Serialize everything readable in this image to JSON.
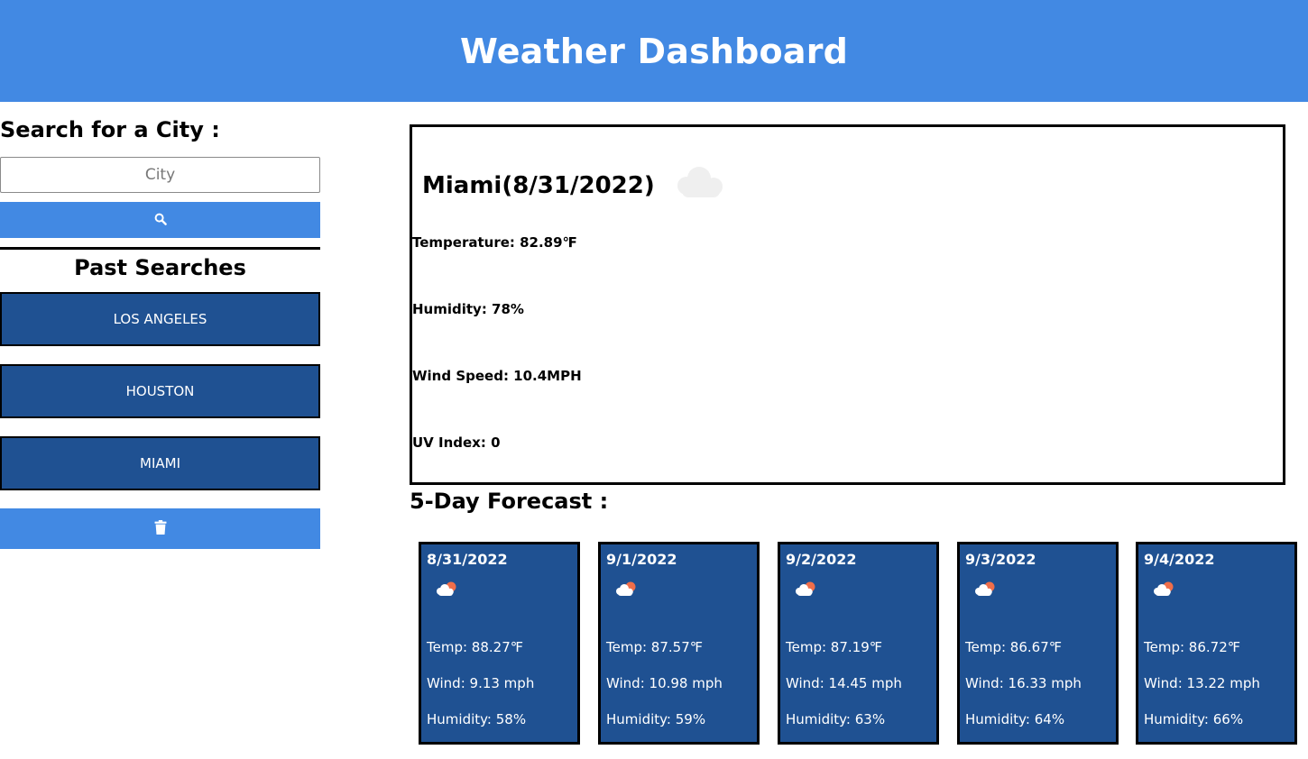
{
  "header": {
    "title": "Weather Dashboard"
  },
  "sidebar": {
    "search_title": "Search for a City :",
    "city_placeholder": "City",
    "city_value": "",
    "search_icon": "search-icon",
    "past_title": "Past Searches",
    "past_searches": [
      "LOS ANGELES",
      "HOUSTON",
      "MIAMI"
    ],
    "clear_icon": "trash-icon"
  },
  "current": {
    "title": "Miami(8/31/2022)",
    "icon": "cloud-icon",
    "temperature": "Temperature: 82.89℉",
    "humidity": "Humidity: 78%",
    "wind": "Wind Speed: 10.4MPH",
    "uv": "UV Index: 0"
  },
  "forecast": {
    "title": "5-Day Forecast :",
    "days": [
      {
        "date": "8/31/2022",
        "icon": "partly-cloudy-icon",
        "temp": "Temp: 88.27℉",
        "wind": "Wind: 9.13 mph",
        "humidity": "Humidity: 58%"
      },
      {
        "date": "9/1/2022",
        "icon": "partly-cloudy-icon",
        "temp": "Temp: 87.57℉",
        "wind": "Wind: 10.98 mph",
        "humidity": "Humidity: 59%"
      },
      {
        "date": "9/2/2022",
        "icon": "partly-cloudy-icon",
        "temp": "Temp: 87.19℉",
        "wind": "Wind: 14.45 mph",
        "humidity": "Humidity: 63%"
      },
      {
        "date": "9/3/2022",
        "icon": "partly-cloudy-icon",
        "temp": "Temp: 86.67℉",
        "wind": "Wind: 16.33 mph",
        "humidity": "Humidity: 64%"
      },
      {
        "date": "9/4/2022",
        "icon": "partly-cloudy-icon",
        "temp": "Temp: 86.72℉",
        "wind": "Wind: 13.22 mph",
        "humidity": "Humidity: 66%"
      }
    ]
  },
  "colors": {
    "header_blue": "#4289e3",
    "card_navy": "#1f5192",
    "sun_orange": "#ef6e4a"
  }
}
